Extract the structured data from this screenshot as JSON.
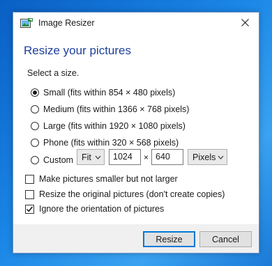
{
  "window": {
    "title": "Image Resizer",
    "close_icon": "close-icon",
    "app_icon": "image-resizer-icon"
  },
  "main": {
    "heading": "Resize your pictures",
    "section_label": "Select a size.",
    "sizes": [
      {
        "label": "Small (fits within 854 × 480 pixels)",
        "selected": true
      },
      {
        "label": "Medium (fits within 1366 × 768 pixels)",
        "selected": false
      },
      {
        "label": "Large (fits within 1920 × 1080 pixels)",
        "selected": false
      },
      {
        "label": "Phone (fits within 320 × 568 pixels)",
        "selected": false
      }
    ],
    "custom": {
      "label": "Custom",
      "selected": false,
      "fit_mode": "Fit",
      "width": "1024",
      "times": "×",
      "height": "640",
      "unit": "Pixels"
    },
    "options": [
      {
        "label": "Make pictures smaller but not larger",
        "checked": false
      },
      {
        "label": "Resize the original pictures (don't create copies)",
        "checked": false
      },
      {
        "label": "Ignore the orientation of pictures",
        "checked": true
      }
    ]
  },
  "footer": {
    "resize_label": "Resize",
    "cancel_label": "Cancel"
  },
  "colors": {
    "heading": "#1e3f9c",
    "accent": "#0078d7"
  }
}
